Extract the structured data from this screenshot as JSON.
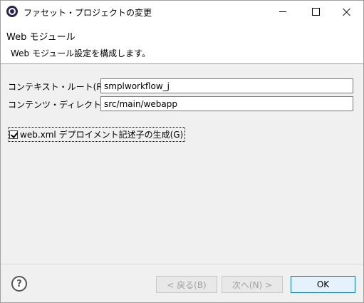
{
  "window": {
    "title": "ファセット・プロジェクトの変更"
  },
  "header": {
    "title": "Web モジュール",
    "message": "Web モジュール設定を構成します。"
  },
  "form": {
    "context_root_label": "コンテキスト・ルート(R):",
    "context_root_value": "smplworkflow_j",
    "content_dir_label": "コンテンツ・ディレクトリー(D):",
    "content_dir_value": "src/main/webapp",
    "generate_dd_label": "web.xml デプロイメント記述子の生成(G)",
    "generate_dd_checked": true
  },
  "footer": {
    "help_symbol": "?",
    "back_label": "< 戻る(B)",
    "next_label": "次へ(N) >",
    "ok_label": "OK"
  },
  "icons": {
    "app": "eclipse-icon",
    "help": "help-icon",
    "minimize": "minimize-icon",
    "maximize": "maximize-icon",
    "close": "close-icon"
  },
  "colors": {
    "dialog_bg": "#f0f0f0",
    "header_bg": "#ffffff",
    "ok_border": "#0078d7",
    "disabled_text": "#a0a0a0"
  }
}
